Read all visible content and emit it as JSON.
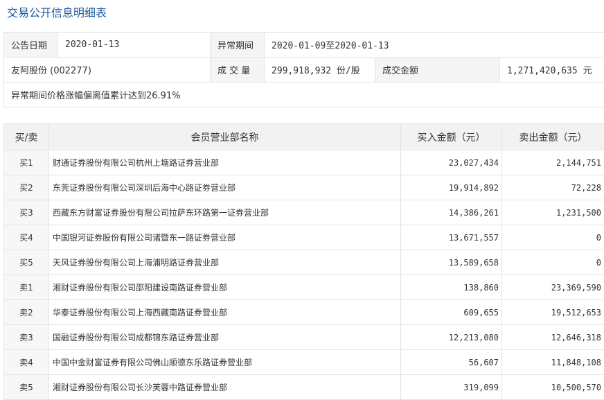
{
  "page": {
    "title": "交易公开信息明细表"
  },
  "info": {
    "announce_date_label": "公告日期",
    "announce_date_value": "2020-01-13",
    "period_label": "异常期间",
    "period_value": "2020-01-09至2020-01-13",
    "stock_name": "友阿股份 (002277)",
    "volume_label": "成 交 量",
    "volume_value": "299,918,932 份/股",
    "amount_label": "成交金额",
    "amount_value": "1,271,420,635 元",
    "note": "异常期间价格涨幅偏离值累计达到26.91%"
  },
  "detail": {
    "headers": {
      "side": "买/卖",
      "branch": "会员营业部名称",
      "buy": "买入金额（元）",
      "sell": "卖出金额（元）"
    },
    "rows": [
      {
        "side": "买1",
        "branch": "财通证券股份有限公司杭州上塘路证券营业部",
        "buy": "23,027,434",
        "sell": "2,144,751"
      },
      {
        "side": "买2",
        "branch": "东莞证券股份有限公司深圳后海中心路证券营业部",
        "buy": "19,914,892",
        "sell": "72,228"
      },
      {
        "side": "买3",
        "branch": "西藏东方财富证券股份有限公司拉萨东环路第一证券营业部",
        "buy": "14,386,261",
        "sell": "1,231,500"
      },
      {
        "side": "买4",
        "branch": "中国银河证券股份有限公司诸暨东一路证券营业部",
        "buy": "13,671,557",
        "sell": "0"
      },
      {
        "side": "买5",
        "branch": "天风证券股份有限公司上海浦明路证券营业部",
        "buy": "13,589,658",
        "sell": "0"
      },
      {
        "side": "卖1",
        "branch": "湘财证券股份有限公司邵阳建设南路证券营业部",
        "buy": "138,860",
        "sell": "23,369,590"
      },
      {
        "side": "卖2",
        "branch": "华泰证券股份有限公司上海西藏南路证券营业部",
        "buy": "609,655",
        "sell": "19,512,653"
      },
      {
        "side": "卖3",
        "branch": "国融证券股份有限公司成都锦东路证券营业部",
        "buy": "12,213,080",
        "sell": "12,646,318"
      },
      {
        "side": "卖4",
        "branch": "中国中金财富证券有限公司佛山顺德东乐路证券营业部",
        "buy": "56,607",
        "sell": "11,848,108"
      },
      {
        "side": "卖5",
        "branch": "湘财证券股份有限公司长沙芙蓉中路证券营业部",
        "buy": "319,099",
        "sell": "10,500,570"
      }
    ]
  }
}
